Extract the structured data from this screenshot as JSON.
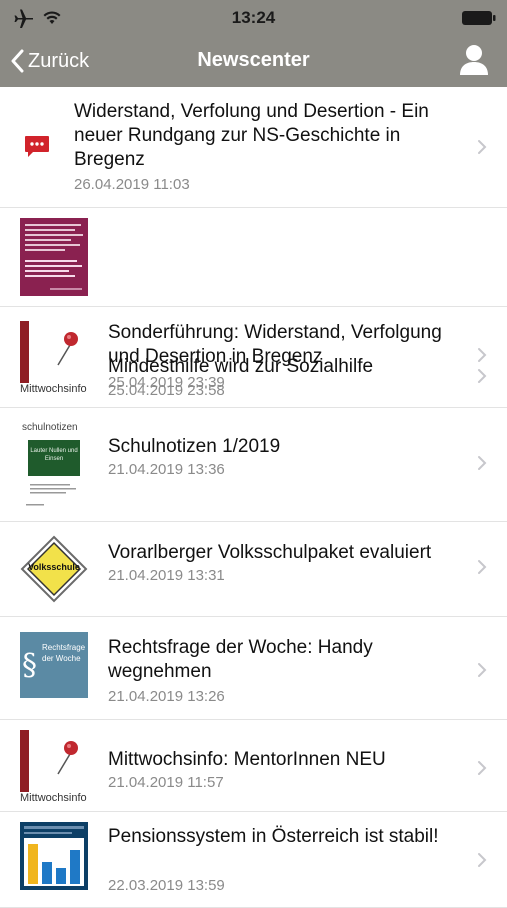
{
  "status_bar": {
    "time": "13:24",
    "icons": [
      "airplane-icon",
      "wifi-icon",
      "battery-icon"
    ]
  },
  "nav": {
    "back_label": "Zurück",
    "title": "Newscenter",
    "user_icon": "user-icon"
  },
  "colors": {
    "header": "#8b8a84",
    "message_icon": "#d1232b",
    "date": "#8a8a8a"
  },
  "news": [
    {
      "title": "Widerstand, Verfolung und Desertion - Ein neuer Rundgang zur NS-Geschichte in Bregenz",
      "date": "26.04.2019 11:03",
      "thumb": "message-icon"
    },
    {
      "title": "Mindesthilfe wird zur Sozialhilfe",
      "date": "25.04.2019 23:58",
      "thumb": "text-poster-thumbnail"
    },
    {
      "title": "Sonderführung: Widerstand, Verfolgung und Desertion in Bregenz",
      "date": "25.04.2019 23:39",
      "thumb": "mittwochsinfo-thumbnail",
      "thumb_label": "Mittwochsinfo"
    },
    {
      "title": "Schulnotizen 1/2019",
      "date": "21.04.2019 13:36",
      "thumb": "schulnotizen-thumbnail",
      "thumb_label": "schulnotizen",
      "board_text": "Lauter Nullen und Einsen"
    },
    {
      "title": "Vorarlberger Volksschulpaket evaluiert",
      "date": "21.04.2019 13:31",
      "thumb": "volksschule-sign-thumbnail",
      "thumb_label": "Volksschule"
    },
    {
      "title": "Rechtsfrage der Woche: Handy wegnehmen",
      "date": "21.04.2019 13:26",
      "thumb": "rechtsfrage-thumbnail",
      "thumb_label": "Rechtsfrage der Woche"
    },
    {
      "title": "Mittwochsinfo: MentorInnen NEU",
      "date": "21.04.2019 11:57",
      "thumb": "mittwochsinfo-thumbnail",
      "thumb_label": "Mittwochsinfo"
    },
    {
      "title": "Pensionssystem in Österreich ist stabil!",
      "date": "22.03.2019 13:59",
      "thumb": "bar-chart-thumbnail"
    }
  ]
}
